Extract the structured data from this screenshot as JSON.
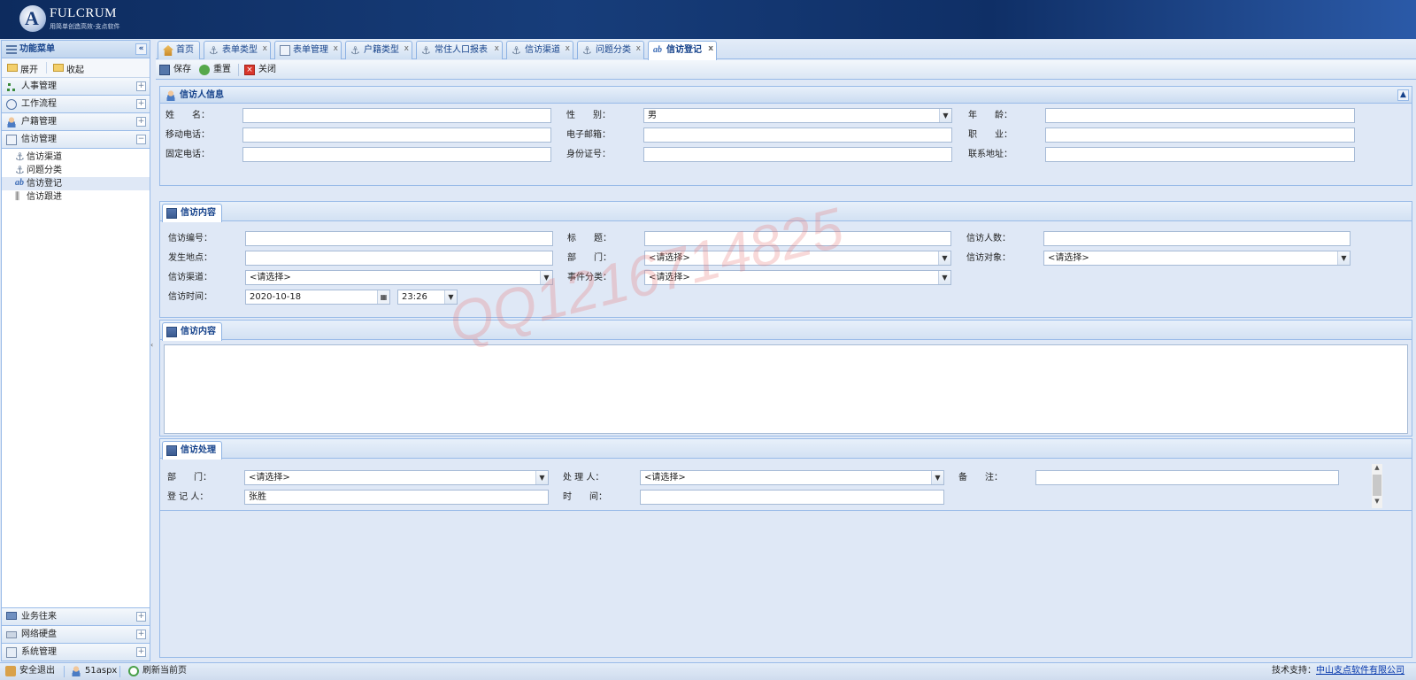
{
  "app": {
    "logo_title": "FULCRUM",
    "logo_subtitle": "用简单创造高效-支点软件",
    "logo_letter": "A"
  },
  "left_panel": {
    "title": "功能菜单",
    "expand_label": "展开",
    "collapse_label": "收起",
    "top_menus": [
      {
        "label": "人事管理",
        "state": "+"
      },
      {
        "label": "工作流程",
        "state": "+"
      },
      {
        "label": "户籍管理",
        "state": "+"
      },
      {
        "label": "信访管理",
        "state": "−"
      }
    ],
    "tree_items": [
      {
        "label": "信访渠道"
      },
      {
        "label": "问题分类"
      },
      {
        "label": "信访登记",
        "active": true
      },
      {
        "label": "信访跟进"
      }
    ],
    "bottom_menus": [
      {
        "label": "业务往来",
        "state": "+"
      },
      {
        "label": "网络硬盘",
        "state": "+"
      },
      {
        "label": "系统管理",
        "state": "+"
      }
    ]
  },
  "tabs": [
    {
      "label": "首页",
      "icon": "home-icon"
    },
    {
      "label": "表单类型",
      "icon": "anchor-icon"
    },
    {
      "label": "表单管理",
      "icon": "form-icon"
    },
    {
      "label": "户籍类型",
      "icon": "anchor-icon"
    },
    {
      "label": "常住人口报表",
      "icon": "anchor-icon"
    },
    {
      "label": "信访渠道",
      "icon": "anchor-icon"
    },
    {
      "label": "问题分类",
      "icon": "anchor-icon"
    },
    {
      "label": "信访登记",
      "icon": "ab-icon",
      "active": true
    }
  ],
  "toolbar": {
    "save": "保存",
    "reset": "重置",
    "close": "关闭"
  },
  "petitioner": {
    "section_title": "信访人信息",
    "name_label": "姓　　名：",
    "name_value": "",
    "gender_label": "性　　别：",
    "gender_value": "男",
    "age_label": "年　　龄：",
    "age_value": "",
    "mobile_label": "移动电话：",
    "mobile_value": "",
    "email_label": "电子邮箱：",
    "email_value": "",
    "job_label": "职　　业：",
    "job_value": "",
    "phone_label": "固定电话：",
    "phone_value": "",
    "idcard_label": "身份证号：",
    "idcard_value": "",
    "address_label": "联系地址：",
    "address_value": ""
  },
  "petition": {
    "tab_title": "信访内容",
    "no_label": "信访编号：",
    "no_value": "",
    "title_label": "标　　题：",
    "title_value": "",
    "count_label": "信访人数：",
    "count_value": "",
    "place_label": "发生地点：",
    "place_value": "",
    "dept_label": "部　　门：",
    "dept_value": "<请选择>",
    "target_label": "信访对象：",
    "target_value": "<请选择>",
    "channel_label": "信访渠道：",
    "channel_value": "<请选择>",
    "category_label": "事件分类：",
    "category_value": "<请选择>",
    "time_label": "信访时间：",
    "date_value": "2020-10-18",
    "clock_value": "23:26"
  },
  "content": {
    "tab_title": "信访内容",
    "text": ""
  },
  "handling": {
    "tab_title": "信访处理",
    "dept_label": "部　　门：",
    "dept_value": "<请选择>",
    "handler_label": "处 理 人：",
    "handler_value": "<请选择>",
    "note_label": "备　　注：",
    "note_value": "",
    "registrar_label": "登 记 人：",
    "registrar_value": "张胜",
    "time_label": "时　　间：",
    "time_value": ""
  },
  "status": {
    "logout": "安全退出",
    "user": "51aspx",
    "refresh": "刷新当前页",
    "support_label": "技术支持：",
    "support_link": "中山支点软件有限公司"
  },
  "watermark": "QQ1216714825",
  "colors": {
    "header": "#173d7a",
    "border": "#99bbe8",
    "title_text": "#15428b",
    "background": "#dfe8f6"
  }
}
